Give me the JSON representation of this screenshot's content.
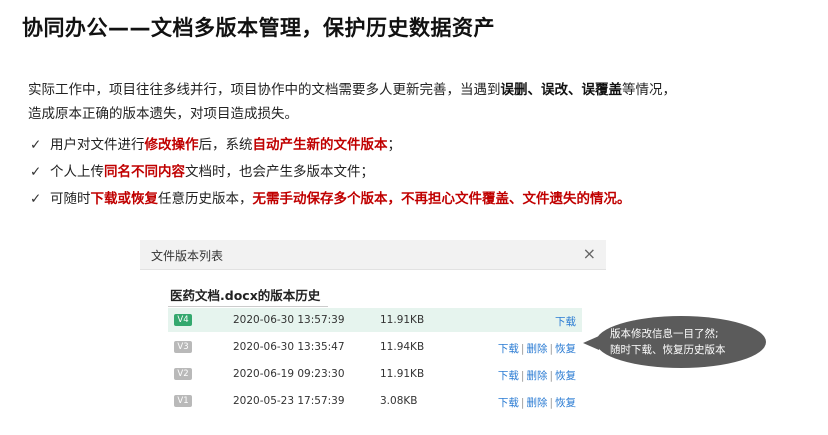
{
  "page_title": "协同办公——文档多版本管理，保护历史数据资产",
  "intro": {
    "line1_a": "实际工作中，项目往往多线并行，项目协作中的文档需要多人更新完善，当遇到",
    "line1_b": "误删、误改、误覆盖",
    "line1_c": "等情况，",
    "line2": "造成原本正确的版本遗失，对项目造成损失。"
  },
  "checks": [
    {
      "a": "用户对文件进行",
      "b": "修改操作",
      "c": "后，系统",
      "d": "自动产生新的文件版本",
      "e": "；"
    },
    {
      "a": "个人上传",
      "b": "同名不同内容",
      "c": "文档时，也会产生多版本文件；"
    },
    {
      "a": "可随时",
      "b": "下载或恢复",
      "c": "任意历史版本，",
      "d": "无需手动保存多个版本，不再担心文件覆盖、文件遗失的情况。"
    }
  ],
  "check_mark": "✓",
  "dialog": {
    "title": "文件版本列表",
    "close": "×",
    "doc_heading": "医药文档.docx的版本历史",
    "rows": [
      {
        "version": "V4",
        "time": "2020-06-30 13:57:39",
        "size": "11.91KB",
        "download": "下载",
        "delete": "",
        "restore": "",
        "selected": true
      },
      {
        "version": "V3",
        "time": "2020-06-30 13:35:47",
        "size": "11.94KB",
        "download": "下载",
        "delete": "删除",
        "restore": "恢复"
      },
      {
        "version": "V2",
        "time": "2020-06-19 09:23:30",
        "size": "11.91KB",
        "download": "下载",
        "delete": "删除",
        "restore": "恢复"
      },
      {
        "version": "V1",
        "time": "2020-05-23 17:57:39",
        "size": "3.08KB",
        "download": "下载",
        "delete": "删除",
        "restore": "恢复"
      }
    ],
    "separator": "|"
  },
  "callout": {
    "line1": "版本修改信息一目了然;",
    "line2": "随时下载、恢复历史版本"
  },
  "colors": {
    "emphasis": "#c00000",
    "selected_row": "#e6f4ee",
    "current_badge": "#34a86e",
    "link": "#2a7bd3"
  }
}
